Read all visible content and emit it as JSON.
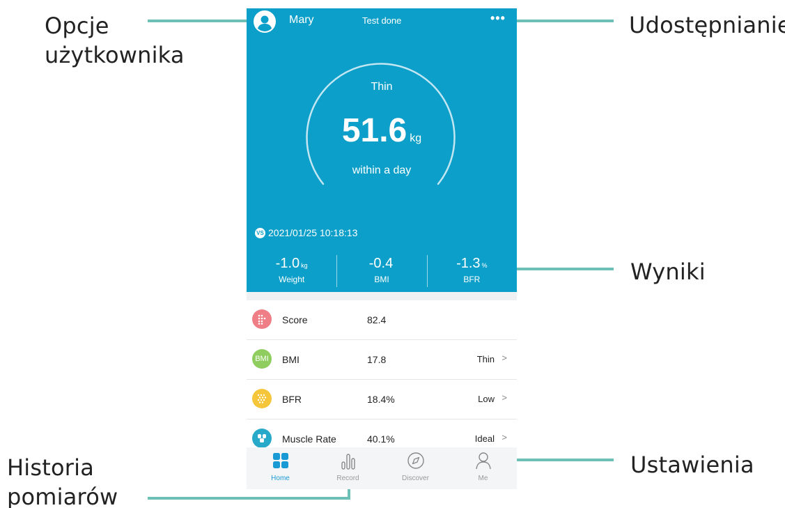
{
  "annotations": {
    "user_options": [
      "Opcje",
      "użytkownika"
    ],
    "sharing": "Udostępnianie",
    "results": "Wyniki",
    "history": [
      "Historia",
      "pomiarów"
    ],
    "settings": "Ustawienia"
  },
  "header": {
    "username": "Mary",
    "status": "Test done",
    "more_icon": "more-dots-icon"
  },
  "gauge": {
    "verdict": "Thin",
    "weight": "51.6",
    "unit": "kg",
    "period": "within a day"
  },
  "comparison": {
    "badge": "VS",
    "timestamp": "2021/01/25 10:18:13",
    "items": [
      {
        "value": "-1.0",
        "unit": "kg",
        "label": "Weight"
      },
      {
        "value": "-0.4",
        "unit": "",
        "label": "BMI"
      },
      {
        "value": "-1.3",
        "unit": "%",
        "label": "BFR"
      }
    ]
  },
  "metrics": [
    {
      "name": "Score",
      "value": "82.4",
      "grade": "",
      "chevron": "",
      "icon": "score-icon",
      "color": "#f07e86",
      "badge": ""
    },
    {
      "name": "BMI",
      "value": "17.8",
      "grade": "Thin",
      "chevron": ">",
      "icon": "bmi-icon",
      "color": "#8fce5e",
      "badge": "BMI"
    },
    {
      "name": "BFR",
      "value": "18.4%",
      "grade": "Low",
      "chevron": ">",
      "icon": "bfr-icon",
      "color": "#f5c63a",
      "badge": ""
    },
    {
      "name": "Muscle Rate",
      "value": "40.1%",
      "grade": "Ideal",
      "chevron": ">",
      "icon": "muscle-icon",
      "color": "#27a9c9",
      "badge": ""
    }
  ],
  "tabs": [
    {
      "label": "Home",
      "icon": "home-grid-icon",
      "active": true
    },
    {
      "label": "Record",
      "icon": "bar-chart-icon",
      "active": false
    },
    {
      "label": "Discover",
      "icon": "compass-icon",
      "active": false
    },
    {
      "label": "Me",
      "icon": "person-icon",
      "active": false
    }
  ],
  "colors": {
    "primary": "#0c9fc9",
    "tab_active": "#1a9ad4",
    "leader_line": "#6cc0b6"
  }
}
